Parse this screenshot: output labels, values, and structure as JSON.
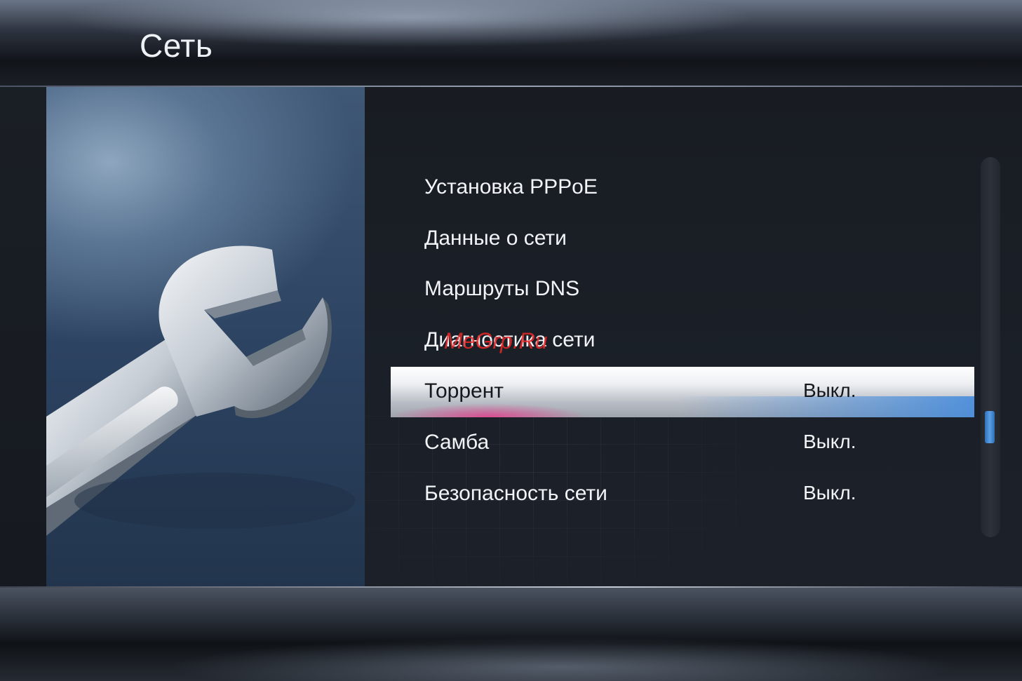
{
  "header": {
    "title": "Сеть"
  },
  "menu": {
    "items": [
      {
        "label": "Установка PPPoE",
        "value": ""
      },
      {
        "label": "Данные о сети",
        "value": ""
      },
      {
        "label": "Маршруты DNS",
        "value": ""
      },
      {
        "label": "Диагностика сети",
        "value": ""
      },
      {
        "label": "Торрент",
        "value": "Выкл.",
        "selected": true
      },
      {
        "label": "Самба",
        "value": "Выкл."
      },
      {
        "label": "Безопасность сети",
        "value": "Выкл."
      }
    ]
  },
  "scrollbar": {
    "position_fraction": 0.73
  },
  "watermark": {
    "text": "MeGrp.Ru"
  },
  "artwork": {
    "icon": "wrench-icon"
  },
  "colors": {
    "highlight_pink": "#e63c8c",
    "highlight_blue": "#468cdc",
    "scroll_thumb": "#3f86d0"
  }
}
